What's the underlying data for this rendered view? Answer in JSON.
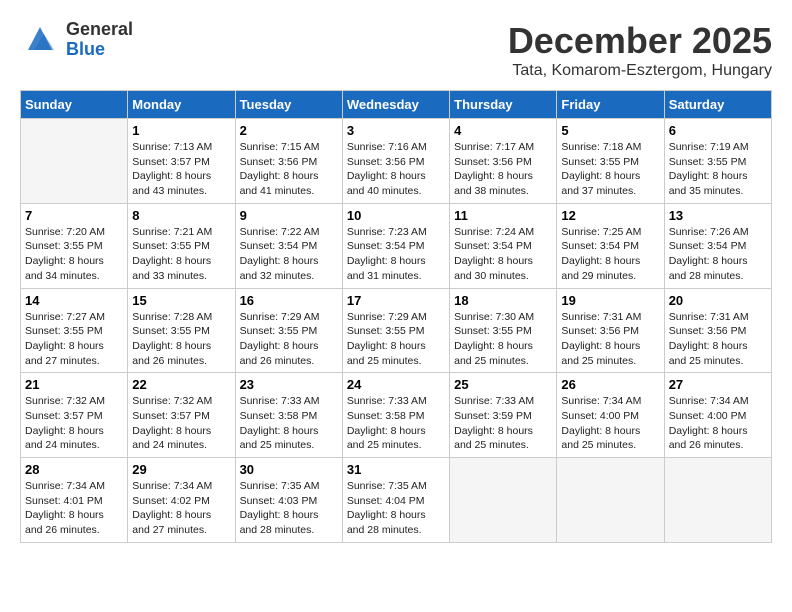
{
  "logo": {
    "general": "General",
    "blue": "Blue"
  },
  "header": {
    "month": "December 2025",
    "location": "Tata, Komarom-Esztergom, Hungary"
  },
  "days_of_week": [
    "Sunday",
    "Monday",
    "Tuesday",
    "Wednesday",
    "Thursday",
    "Friday",
    "Saturday"
  ],
  "weeks": [
    [
      {
        "day": "",
        "info": ""
      },
      {
        "day": "1",
        "info": "Sunrise: 7:13 AM\nSunset: 3:57 PM\nDaylight: 8 hours\nand 43 minutes."
      },
      {
        "day": "2",
        "info": "Sunrise: 7:15 AM\nSunset: 3:56 PM\nDaylight: 8 hours\nand 41 minutes."
      },
      {
        "day": "3",
        "info": "Sunrise: 7:16 AM\nSunset: 3:56 PM\nDaylight: 8 hours\nand 40 minutes."
      },
      {
        "day": "4",
        "info": "Sunrise: 7:17 AM\nSunset: 3:56 PM\nDaylight: 8 hours\nand 38 minutes."
      },
      {
        "day": "5",
        "info": "Sunrise: 7:18 AM\nSunset: 3:55 PM\nDaylight: 8 hours\nand 37 minutes."
      },
      {
        "day": "6",
        "info": "Sunrise: 7:19 AM\nSunset: 3:55 PM\nDaylight: 8 hours\nand 35 minutes."
      }
    ],
    [
      {
        "day": "7",
        "info": "Sunrise: 7:20 AM\nSunset: 3:55 PM\nDaylight: 8 hours\nand 34 minutes."
      },
      {
        "day": "8",
        "info": "Sunrise: 7:21 AM\nSunset: 3:55 PM\nDaylight: 8 hours\nand 33 minutes."
      },
      {
        "day": "9",
        "info": "Sunrise: 7:22 AM\nSunset: 3:54 PM\nDaylight: 8 hours\nand 32 minutes."
      },
      {
        "day": "10",
        "info": "Sunrise: 7:23 AM\nSunset: 3:54 PM\nDaylight: 8 hours\nand 31 minutes."
      },
      {
        "day": "11",
        "info": "Sunrise: 7:24 AM\nSunset: 3:54 PM\nDaylight: 8 hours\nand 30 minutes."
      },
      {
        "day": "12",
        "info": "Sunrise: 7:25 AM\nSunset: 3:54 PM\nDaylight: 8 hours\nand 29 minutes."
      },
      {
        "day": "13",
        "info": "Sunrise: 7:26 AM\nSunset: 3:54 PM\nDaylight: 8 hours\nand 28 minutes."
      }
    ],
    [
      {
        "day": "14",
        "info": "Sunrise: 7:27 AM\nSunset: 3:55 PM\nDaylight: 8 hours\nand 27 minutes."
      },
      {
        "day": "15",
        "info": "Sunrise: 7:28 AM\nSunset: 3:55 PM\nDaylight: 8 hours\nand 26 minutes."
      },
      {
        "day": "16",
        "info": "Sunrise: 7:29 AM\nSunset: 3:55 PM\nDaylight: 8 hours\nand 26 minutes."
      },
      {
        "day": "17",
        "info": "Sunrise: 7:29 AM\nSunset: 3:55 PM\nDaylight: 8 hours\nand 25 minutes."
      },
      {
        "day": "18",
        "info": "Sunrise: 7:30 AM\nSunset: 3:55 PM\nDaylight: 8 hours\nand 25 minutes."
      },
      {
        "day": "19",
        "info": "Sunrise: 7:31 AM\nSunset: 3:56 PM\nDaylight: 8 hours\nand 25 minutes."
      },
      {
        "day": "20",
        "info": "Sunrise: 7:31 AM\nSunset: 3:56 PM\nDaylight: 8 hours\nand 25 minutes."
      }
    ],
    [
      {
        "day": "21",
        "info": "Sunrise: 7:32 AM\nSunset: 3:57 PM\nDaylight: 8 hours\nand 24 minutes."
      },
      {
        "day": "22",
        "info": "Sunrise: 7:32 AM\nSunset: 3:57 PM\nDaylight: 8 hours\nand 24 minutes."
      },
      {
        "day": "23",
        "info": "Sunrise: 7:33 AM\nSunset: 3:58 PM\nDaylight: 8 hours\nand 25 minutes."
      },
      {
        "day": "24",
        "info": "Sunrise: 7:33 AM\nSunset: 3:58 PM\nDaylight: 8 hours\nand 25 minutes."
      },
      {
        "day": "25",
        "info": "Sunrise: 7:33 AM\nSunset: 3:59 PM\nDaylight: 8 hours\nand 25 minutes."
      },
      {
        "day": "26",
        "info": "Sunrise: 7:34 AM\nSunset: 4:00 PM\nDaylight: 8 hours\nand 25 minutes."
      },
      {
        "day": "27",
        "info": "Sunrise: 7:34 AM\nSunset: 4:00 PM\nDaylight: 8 hours\nand 26 minutes."
      }
    ],
    [
      {
        "day": "28",
        "info": "Sunrise: 7:34 AM\nSunset: 4:01 PM\nDaylight: 8 hours\nand 26 minutes."
      },
      {
        "day": "29",
        "info": "Sunrise: 7:34 AM\nSunset: 4:02 PM\nDaylight: 8 hours\nand 27 minutes."
      },
      {
        "day": "30",
        "info": "Sunrise: 7:35 AM\nSunset: 4:03 PM\nDaylight: 8 hours\nand 28 minutes."
      },
      {
        "day": "31",
        "info": "Sunrise: 7:35 AM\nSunset: 4:04 PM\nDaylight: 8 hours\nand 28 minutes."
      },
      {
        "day": "",
        "info": ""
      },
      {
        "day": "",
        "info": ""
      },
      {
        "day": "",
        "info": ""
      }
    ]
  ]
}
